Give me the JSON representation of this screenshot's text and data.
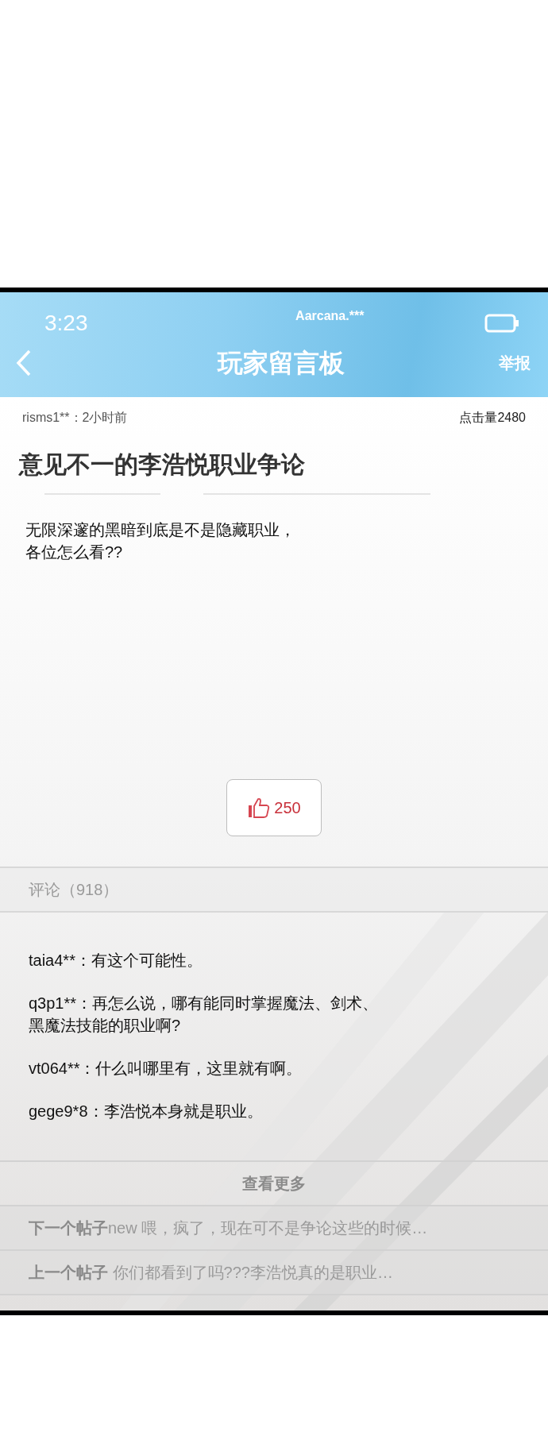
{
  "status_bar": {
    "time": "3:23",
    "carrier": "Aarcana.***"
  },
  "nav": {
    "title": "玩家留言板",
    "action": "举报"
  },
  "post": {
    "author_time": "risms1**：2小时前",
    "views": "点击量2480",
    "title": "意见不一的李浩悦职业争论",
    "body": [
      "无限深邃的黑暗到底是不是隐藏职业，",
      "各位怎么看??"
    ],
    "likes": "250"
  },
  "comments_header": "评论（918）",
  "comments": [
    {
      "text": "taia4**：有这个可能性。"
    },
    {
      "text": "q3p1**：再怎么说，哪有能同时掌握魔法、剑术、黑魔法技能的职业啊?"
    },
    {
      "text": "vt064**：什么叫哪里有，这里就有啊。"
    },
    {
      "text": "gege9*8：李浩悦本身就是职业。"
    }
  ],
  "more": "查看更多",
  "adjacent_posts": [
    {
      "label": "下一个帖子",
      "title": "new 喂，疯了，现在可不是争论这些的时候…"
    },
    {
      "label": "上一个帖子",
      "title": " 你们都看到了吗???李浩悦真的是职业…"
    }
  ]
}
